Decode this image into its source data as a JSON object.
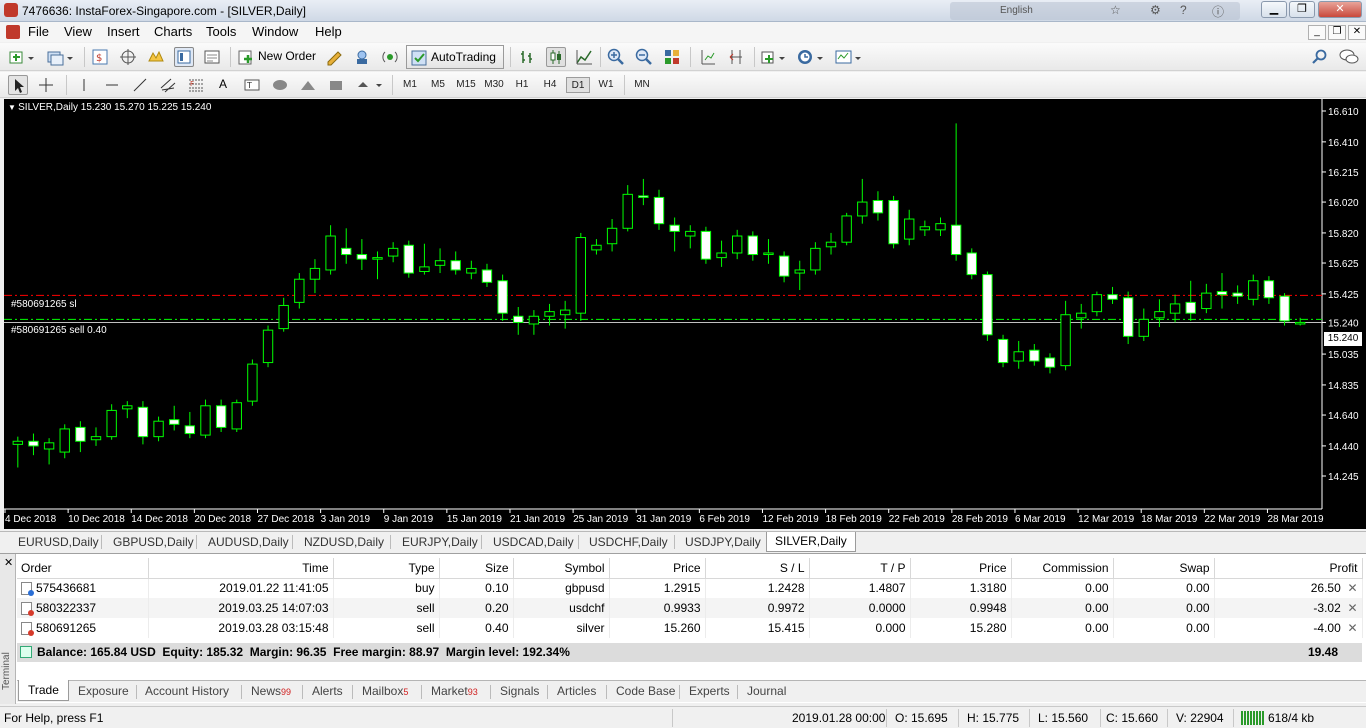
{
  "window": {
    "title": "7476636: InstaForex-Singapore.com - [SILVER,Daily]",
    "language": "English"
  },
  "menu": [
    "File",
    "View",
    "Insert",
    "Charts",
    "Tools",
    "Window",
    "Help"
  ],
  "toolbar": {
    "new_order": "New Order",
    "auto_trading": "AutoTrading",
    "timeframes": [
      "M1",
      "M5",
      "M15",
      "M30",
      "H1",
      "H4",
      "D1",
      "W1",
      "MN"
    ],
    "active_timeframe": "D1"
  },
  "chart": {
    "header": "SILVER,Daily  15.230 15.270 15.225 15.240",
    "sl_label": "#580691265 sl",
    "order_label": "#580691265 sell 0.40",
    "current_price": "15.240",
    "colors": {
      "background": "#000000",
      "candle": "#00ff00",
      "sl_line": "#ff0000",
      "order_line": "#00ff00",
      "price_line": "#c0c0c0"
    }
  },
  "chart_data": {
    "type": "candlestick",
    "symbol": "SILVER",
    "timeframe": "Daily",
    "y_ticks": [
      "16.610",
      "16.410",
      "16.215",
      "16.020",
      "15.820",
      "15.625",
      "15.425",
      "15.240",
      "15.035",
      "14.835",
      "14.640",
      "14.440",
      "14.245"
    ],
    "ylim": [
      14.245,
      16.61
    ],
    "x_tick_labels": [
      "4 Dec 2018",
      "10 Dec 2018",
      "14 Dec 2018",
      "20 Dec 2018",
      "27 Dec 2018",
      "3 Jan 2019",
      "9 Jan 2019",
      "15 Jan 2019",
      "21 Jan 2019",
      "25 Jan 2019",
      "31 Jan 2019",
      "6 Feb 2019",
      "12 Feb 2019",
      "18 Feb 2019",
      "22 Feb 2019",
      "28 Feb 2019",
      "6 Mar 2019",
      "12 Mar 2019",
      "18 Mar 2019",
      "22 Mar 2019",
      "28 Mar 2019"
    ],
    "sl_level": 15.415,
    "order_level": 15.26,
    "last_price": 15.24,
    "candles": [
      [
        14.45,
        14.47,
        14.3,
        14.5
      ],
      [
        14.47,
        14.44,
        14.38,
        14.52
      ],
      [
        14.42,
        14.46,
        14.32,
        14.49
      ],
      [
        14.4,
        14.55,
        14.36,
        14.58
      ],
      [
        14.56,
        14.47,
        14.4,
        14.6
      ],
      [
        14.48,
        14.5,
        14.44,
        14.56
      ],
      [
        14.5,
        14.67,
        14.48,
        14.71
      ],
      [
        14.68,
        14.7,
        14.62,
        14.73
      ],
      [
        14.69,
        14.5,
        14.45,
        14.73
      ],
      [
        14.5,
        14.6,
        14.47,
        14.63
      ],
      [
        14.61,
        14.58,
        14.54,
        14.7
      ],
      [
        14.57,
        14.52,
        14.49,
        14.66
      ],
      [
        14.51,
        14.7,
        14.49,
        14.74
      ],
      [
        14.7,
        14.56,
        14.53,
        14.74
      ],
      [
        14.55,
        14.72,
        14.53,
        14.74
      ],
      [
        14.73,
        14.97,
        14.7,
        15.0
      ],
      [
        14.98,
        15.19,
        14.95,
        15.22
      ],
      [
        15.2,
        15.35,
        15.18,
        15.4
      ],
      [
        15.37,
        15.52,
        15.33,
        15.56
      ],
      [
        15.52,
        15.59,
        15.43,
        15.65
      ],
      [
        15.58,
        15.8,
        15.55,
        15.87
      ],
      [
        15.72,
        15.68,
        15.62,
        15.85
      ],
      [
        15.68,
        15.65,
        15.58,
        15.78
      ],
      [
        15.65,
        15.66,
        15.52,
        15.7
      ],
      [
        15.67,
        15.72,
        15.63,
        15.76
      ],
      [
        15.74,
        15.56,
        15.53,
        15.77
      ],
      [
        15.57,
        15.6,
        15.55,
        15.75
      ],
      [
        15.61,
        15.64,
        15.56,
        15.72
      ],
      [
        15.64,
        15.58,
        15.55,
        15.7
      ],
      [
        15.56,
        15.59,
        15.52,
        15.64
      ],
      [
        15.58,
        15.5,
        15.47,
        15.62
      ],
      [
        15.51,
        15.3,
        15.25,
        15.55
      ],
      [
        15.28,
        15.24,
        15.16,
        15.34
      ],
      [
        15.23,
        15.28,
        15.16,
        15.32
      ],
      [
        15.28,
        15.31,
        15.22,
        15.36
      ],
      [
        15.29,
        15.32,
        15.2,
        15.38
      ],
      [
        15.3,
        15.79,
        15.25,
        15.82
      ],
      [
        15.71,
        15.74,
        15.68,
        15.78
      ],
      [
        15.75,
        15.85,
        15.7,
        15.91
      ],
      [
        15.85,
        16.07,
        15.83,
        16.13
      ],
      [
        16.06,
        16.05,
        16.0,
        16.17
      ],
      [
        16.05,
        15.88,
        15.84,
        16.1
      ],
      [
        15.87,
        15.83,
        15.7,
        15.92
      ],
      [
        15.8,
        15.83,
        15.72,
        15.87
      ],
      [
        15.83,
        15.65,
        15.62,
        15.86
      ],
      [
        15.66,
        15.69,
        15.6,
        15.77
      ],
      [
        15.69,
        15.8,
        15.65,
        15.84
      ],
      [
        15.8,
        15.68,
        15.64,
        15.83
      ],
      [
        15.68,
        15.69,
        15.62,
        15.78
      ],
      [
        15.67,
        15.54,
        15.5,
        15.7
      ],
      [
        15.56,
        15.58,
        15.45,
        15.64
      ],
      [
        15.58,
        15.72,
        15.55,
        15.76
      ],
      [
        15.73,
        15.76,
        15.68,
        15.82
      ],
      [
        15.76,
        15.93,
        15.74,
        15.95
      ],
      [
        15.93,
        16.02,
        15.88,
        16.17
      ],
      [
        16.03,
        15.95,
        15.9,
        16.09
      ],
      [
        16.03,
        15.75,
        15.72,
        16.06
      ],
      [
        15.78,
        15.91,
        15.74,
        15.97
      ],
      [
        15.84,
        15.86,
        15.8,
        15.9
      ],
      [
        15.84,
        15.88,
        15.8,
        15.92
      ],
      [
        15.87,
        15.68,
        15.64,
        16.53
      ],
      [
        15.69,
        15.55,
        15.52,
        15.72
      ],
      [
        15.55,
        15.16,
        15.12,
        15.57
      ],
      [
        15.13,
        14.98,
        14.95,
        15.16
      ],
      [
        14.99,
        15.05,
        14.94,
        15.12
      ],
      [
        15.06,
        14.99,
        14.96,
        15.1
      ],
      [
        15.01,
        14.95,
        14.91,
        15.04
      ],
      [
        14.96,
        15.29,
        14.93,
        15.38
      ],
      [
        15.27,
        15.3,
        15.2,
        15.36
      ],
      [
        15.31,
        15.42,
        15.28,
        15.44
      ],
      [
        15.42,
        15.39,
        15.36,
        15.47
      ],
      [
        15.4,
        15.15,
        15.1,
        15.44
      ],
      [
        15.15,
        15.26,
        15.12,
        15.33
      ],
      [
        15.27,
        15.31,
        15.21,
        15.39
      ],
      [
        15.3,
        15.36,
        15.24,
        15.42
      ],
      [
        15.37,
        15.3,
        15.25,
        15.51
      ],
      [
        15.33,
        15.43,
        15.3,
        15.49
      ],
      [
        15.44,
        15.42,
        15.33,
        15.56
      ],
      [
        15.43,
        15.41,
        15.36,
        15.48
      ],
      [
        15.39,
        15.51,
        15.35,
        15.55
      ],
      [
        15.51,
        15.4,
        15.36,
        15.54
      ],
      [
        15.41,
        15.25,
        15.22,
        15.43
      ],
      [
        15.23,
        15.24,
        15.22,
        15.27
      ]
    ]
  },
  "chart_tabs": [
    "EURUSD,Daily",
    "GBPUSD,Daily",
    "AUDUSD,Daily",
    "NZDUSD,Daily",
    "EURJPY,Daily",
    "USDCAD,Daily",
    "USDCHF,Daily",
    "USDJPY,Daily",
    "SILVER,Daily"
  ],
  "active_chart_tab": "SILVER,Daily",
  "terminal": {
    "side_label": "Terminal",
    "columns": [
      "Order",
      "Time",
      "Type",
      "Size",
      "Symbol",
      "Price",
      "S / L",
      "T / P",
      "Price",
      "Commission",
      "Swap",
      "Profit"
    ],
    "orders": [
      {
        "order": "575436681",
        "time": "2019.01.22 11:41:05",
        "type": "buy",
        "size": "0.10",
        "symbol": "gbpusd",
        "price": "1.2915",
        "sl": "1.2428",
        "tp": "1.4807",
        "cur_price": "1.3180",
        "commission": "0.00",
        "swap": "0.00",
        "profit": "26.50"
      },
      {
        "order": "580322337",
        "time": "2019.03.25 14:07:03",
        "type": "sell",
        "size": "0.20",
        "symbol": "usdchf",
        "price": "0.9933",
        "sl": "0.9972",
        "tp": "0.0000",
        "cur_price": "0.9948",
        "commission": "0.00",
        "swap": "0.00",
        "profit": "-3.02"
      },
      {
        "order": "580691265",
        "time": "2019.03.28 03:15:48",
        "type": "sell",
        "size": "0.40",
        "symbol": "silver",
        "price": "15.260",
        "sl": "15.415",
        "tp": "0.000",
        "cur_price": "15.280",
        "commission": "0.00",
        "swap": "0.00",
        "profit": "-4.00"
      }
    ],
    "balance_line": "Balance: 165.84 USD  Equity: 185.32  Margin: 96.35  Free margin: 88.97  Margin level: 192.34%",
    "total_profit": "19.48",
    "tabs": [
      {
        "label": "Trade",
        "badge": ""
      },
      {
        "label": "Exposure",
        "badge": ""
      },
      {
        "label": "Account History",
        "badge": ""
      },
      {
        "label": "News",
        "badge": "99"
      },
      {
        "label": "Alerts",
        "badge": ""
      },
      {
        "label": "Mailbox",
        "badge": "5"
      },
      {
        "label": "Market",
        "badge": "93"
      },
      {
        "label": "Signals",
        "badge": ""
      },
      {
        "label": "Articles",
        "badge": ""
      },
      {
        "label": "Code Base",
        "badge": ""
      },
      {
        "label": "Experts",
        "badge": ""
      },
      {
        "label": "Journal",
        "badge": ""
      }
    ]
  },
  "status": {
    "help": "For Help, press F1",
    "datetime": "2019.01.28 00:00",
    "open": "O: 15.695",
    "high": "H: 15.775",
    "low": "L: 15.560",
    "close": "C: 15.660",
    "volume": "V: 22904",
    "traffic": "618/4 kb"
  }
}
